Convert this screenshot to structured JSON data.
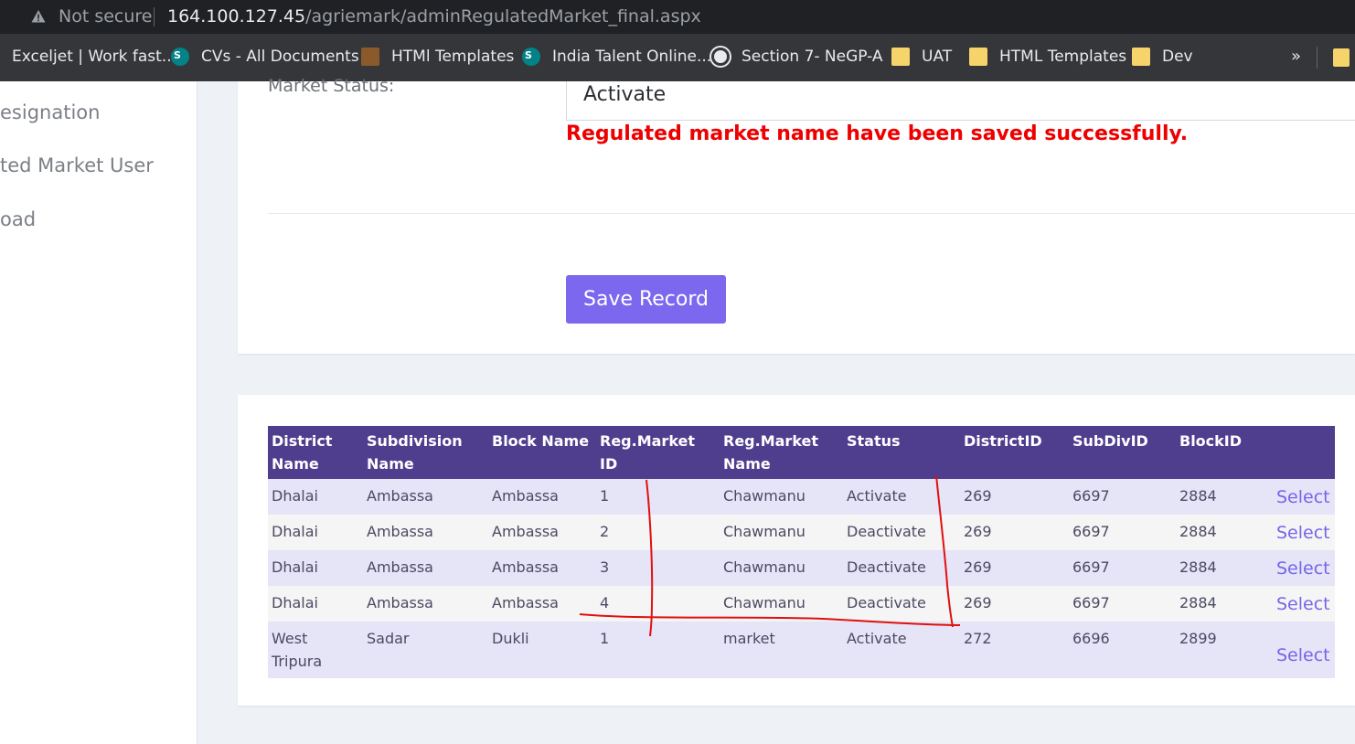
{
  "browser": {
    "not_secure": "Not secure",
    "url_host": "164.100.127.45",
    "url_path": "/agriemark/adminRegulatedMarket_final.aspx"
  },
  "bookmarks": [
    {
      "label": "Exceljet | Work fast...",
      "icon": "exceljet-icon"
    },
    {
      "label": "CVs - All Documents",
      "icon": "sharepoint-icon"
    },
    {
      "label": "HTMl Templates",
      "icon": "template-icon"
    },
    {
      "label": "India Talent Online...",
      "icon": "sharepoint-icon"
    },
    {
      "label": "Section 7- NeGP-A",
      "icon": "globe-icon"
    },
    {
      "label": "UAT",
      "icon": "folder-icon"
    },
    {
      "label": "HTML Templates",
      "icon": "folder-icon"
    },
    {
      "label": "Dev",
      "icon": "folder-icon"
    }
  ],
  "bookmarks_more": "»",
  "sidebar": {
    "items": [
      "esignation",
      "ted Market User",
      "oad"
    ]
  },
  "form": {
    "status_label": "Market Status:",
    "status_value": "Activate",
    "success_message": "Regulated market name have been saved successfully.",
    "save_button": "Save Record"
  },
  "table": {
    "headers": [
      "District Name",
      "Subdivision Name",
      "Block Name",
      "Reg.Market ID",
      "Reg.Market Name",
      "Status",
      "DistrictID",
      "SubDivID",
      "BlockID",
      ""
    ],
    "rows": [
      [
        "Dhalai",
        "Ambassa",
        "Ambassa",
        "1",
        "Chawmanu",
        "Activate",
        "269",
        "6697",
        "2884",
        "Select"
      ],
      [
        "Dhalai",
        "Ambassa",
        "Ambassa",
        "2",
        "Chawmanu",
        "Deactivate",
        "269",
        "6697",
        "2884",
        "Select"
      ],
      [
        "Dhalai",
        "Ambassa",
        "Ambassa",
        "3",
        "Chawmanu",
        "Deactivate",
        "269",
        "6697",
        "2884",
        "Select"
      ],
      [
        "Dhalai",
        "Ambassa",
        "Ambassa",
        "4",
        "Chawmanu",
        "Deactivate",
        "269",
        "6697",
        "2884",
        "Select"
      ],
      [
        "West Tripura",
        "Sadar",
        "Dukli",
        "1",
        "market",
        "Activate",
        "272",
        "6696",
        "2899",
        "Select"
      ]
    ]
  },
  "colors": {
    "header_bg": "#4f3e8e",
    "button_bg": "#7b68ee",
    "success_text": "#ee0000",
    "annotation": "#e01010"
  }
}
